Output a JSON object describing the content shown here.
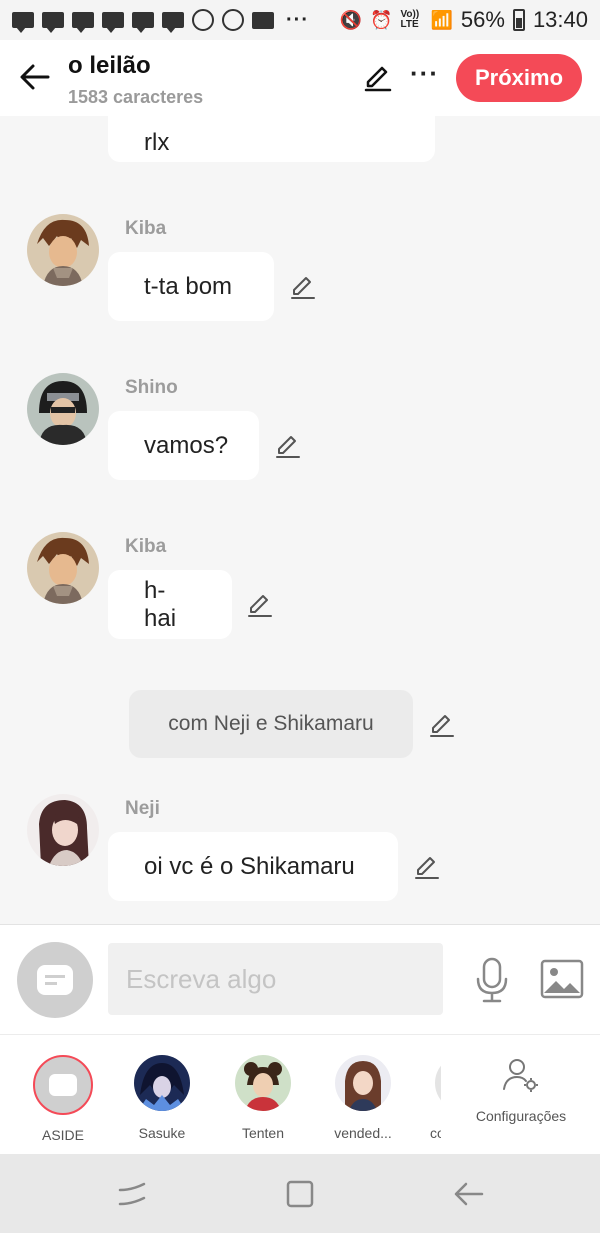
{
  "status": {
    "battery": "56%",
    "time": "13:40",
    "network": "Vo)) LTE"
  },
  "header": {
    "title": "o leilão",
    "subtitle": "1583 caracteres",
    "next_label": "Próximo"
  },
  "messages": [
    {
      "kind": "partial",
      "text": "rlx"
    },
    {
      "kind": "message",
      "author": "Kiba",
      "text": "t-ta bom"
    },
    {
      "kind": "message",
      "author": "Shino",
      "text": "vamos?"
    },
    {
      "kind": "message",
      "author": "Kiba",
      "text": "h-hai"
    },
    {
      "kind": "narration",
      "text": "com Neji e Shikamaru"
    },
    {
      "kind": "message",
      "author": "Neji",
      "text": "oi vc é o Shikamaru"
    }
  ],
  "input": {
    "placeholder": "Escreva algo"
  },
  "characters": [
    {
      "label": "ASIDE"
    },
    {
      "label": "Sasuke"
    },
    {
      "label": "Tenten"
    },
    {
      "label": "vended..."
    },
    {
      "label": "co"
    }
  ],
  "settings_label": "Configurações",
  "colors": {
    "accent": "#f44a57",
    "background": "#f6f6f6",
    "bubble": "#ffffff"
  }
}
